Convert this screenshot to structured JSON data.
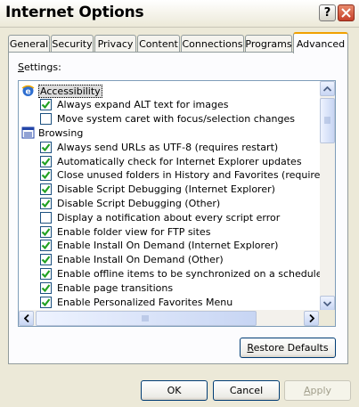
{
  "window": {
    "title": "Internet Options"
  },
  "tabs": [
    {
      "label": "General",
      "active": false
    },
    {
      "label": "Security",
      "active": false
    },
    {
      "label": "Privacy",
      "active": false
    },
    {
      "label": "Content",
      "active": false
    },
    {
      "label": "Connections",
      "active": false
    },
    {
      "label": "Programs",
      "active": false
    },
    {
      "label": "Advanced",
      "active": true
    }
  ],
  "settings": {
    "label": "Settings:",
    "label_underline": "S",
    "label_rest": "ettings:",
    "categories": [
      {
        "label": "Accessibility",
        "icon": "accessibility-icon",
        "items": [
          {
            "label": "Always expand ALT text for images",
            "checked": true
          },
          {
            "label": "Move system caret with focus/selection changes",
            "checked": false
          }
        ]
      },
      {
        "label": "Browsing",
        "icon": "browsing-icon",
        "items": [
          {
            "label": "Always send URLs as UTF-8 (requires restart)",
            "checked": true
          },
          {
            "label": "Automatically check for Internet Explorer updates",
            "checked": true
          },
          {
            "label": "Close unused folders in History and Favorites (requires restart)",
            "checked": true
          },
          {
            "label": "Disable Script Debugging (Internet Explorer)",
            "checked": true
          },
          {
            "label": "Disable Script Debugging (Other)",
            "checked": true
          },
          {
            "label": "Display a notification about every script error",
            "checked": false
          },
          {
            "label": "Enable folder view for FTP sites",
            "checked": true
          },
          {
            "label": "Enable Install On Demand (Internet Explorer)",
            "checked": true
          },
          {
            "label": "Enable Install On Demand (Other)",
            "checked": true
          },
          {
            "label": "Enable offline items to be synchronized on a schedule",
            "checked": true
          },
          {
            "label": "Enable page transitions",
            "checked": true
          },
          {
            "label": "Enable Personalized Favorites Menu",
            "checked": true
          }
        ]
      }
    ]
  },
  "buttons": {
    "restore_underline": "R",
    "restore_rest": "estore Defaults",
    "ok": "OK",
    "cancel": "Cancel",
    "apply_underline": "A",
    "apply_rest": "pply"
  },
  "colors": {
    "dialog_bg": "#ece9d8",
    "check": "#21a121",
    "accent_tab": "#f0a000"
  }
}
